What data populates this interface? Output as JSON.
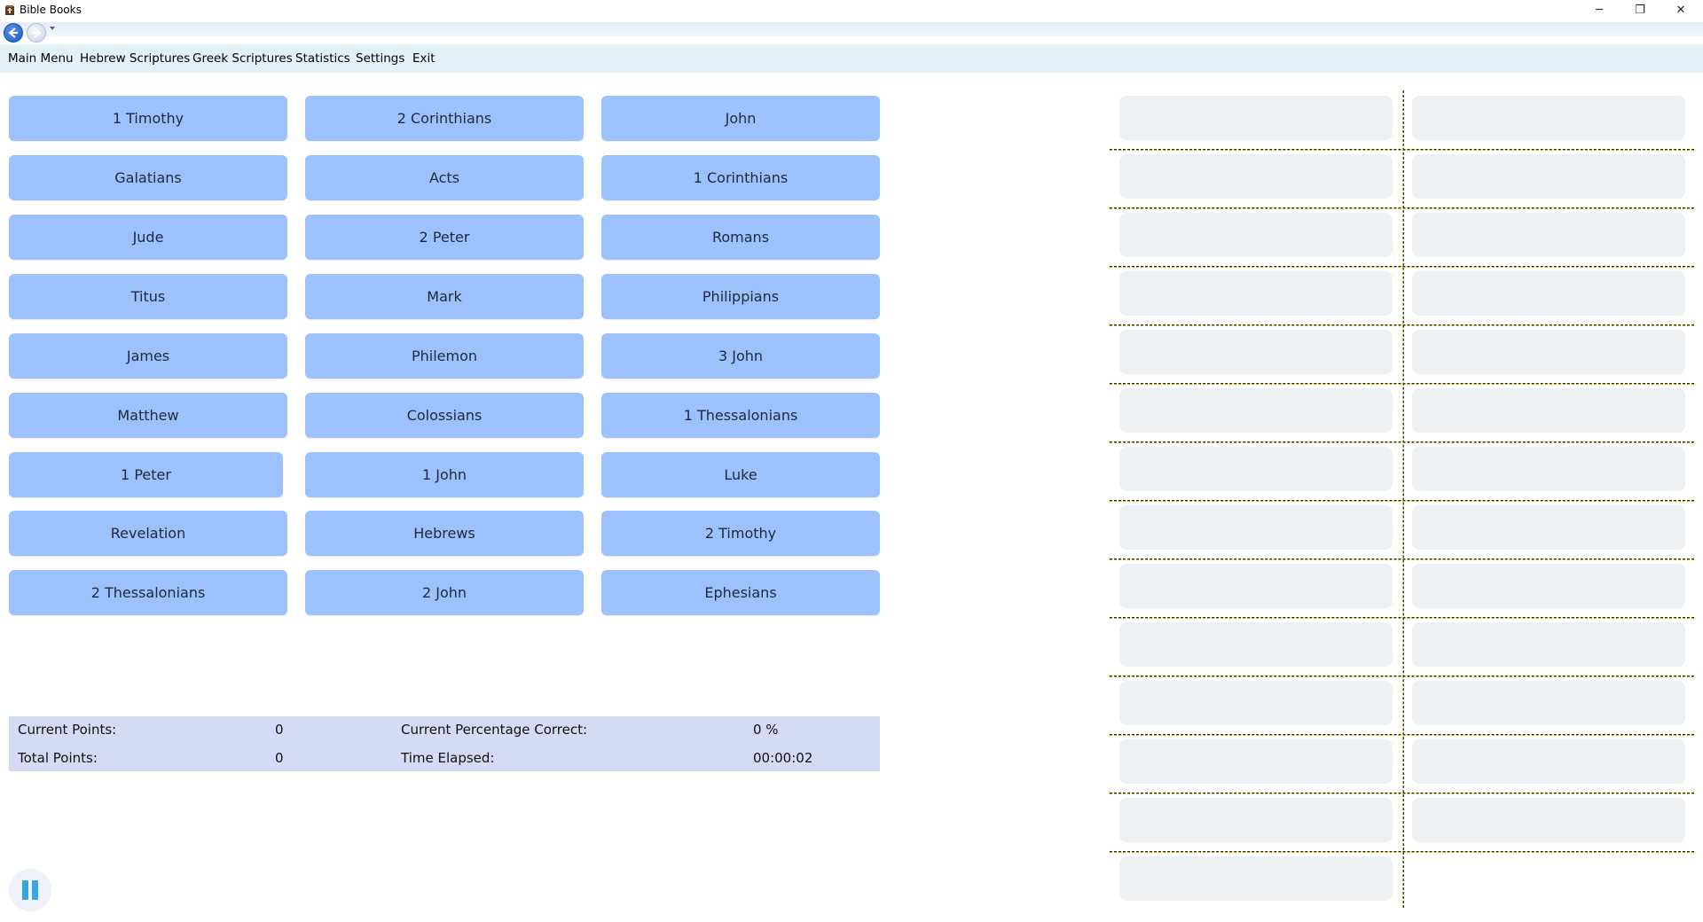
{
  "window": {
    "title": "Bible Books",
    "minimize": "─",
    "restore": "❐",
    "close": "✕"
  },
  "menu": [
    {
      "label": "Main Menu"
    },
    {
      "label": "Hebrew Scriptures"
    },
    {
      "label": "Greek Scriptures"
    },
    {
      "label": "Statistics"
    },
    {
      "label": "Settings"
    },
    {
      "label": "Exit"
    }
  ],
  "books": [
    [
      "1 Timothy",
      "2 Corinthians",
      "John"
    ],
    [
      "Galatians",
      "Acts",
      "1 Corinthians"
    ],
    [
      "Jude",
      "2 Peter",
      "Romans"
    ],
    [
      "Titus",
      "Mark",
      "Philippians"
    ],
    [
      "James",
      "Philemon",
      "3 John"
    ],
    [
      "Matthew",
      "Colossians",
      "1 Thessalonians"
    ],
    [
      "1 Peter",
      "1 John",
      "Luke"
    ],
    [
      "Revelation",
      "Hebrews",
      "2 Timothy"
    ],
    [
      "2 Thessalonians",
      "2 John",
      "Ephesians"
    ]
  ],
  "stats": {
    "current_points_label": "Current Points:",
    "current_points_value": "0",
    "total_points_label": "Total Points:",
    "total_points_value": "0",
    "pct_label": "Current Percentage Correct:",
    "pct_value": "0 %",
    "time_label": "Time Elapsed:",
    "time_value": "00:00:02"
  },
  "colors": {
    "book_button": "#9dc1fd",
    "stats_panel": "#d4dbf5",
    "menubar": "#e4f0f8",
    "slot": "#eef1f4"
  },
  "icons": {
    "app": "bible-book-icon",
    "back": "back-arrow-icon",
    "forward": "forward-arrow-icon",
    "pause": "pause-icon"
  }
}
